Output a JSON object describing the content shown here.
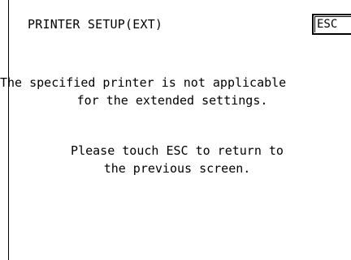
{
  "header": {
    "title": "PRINTER SETUP(EXT)",
    "esc_label": "ESC"
  },
  "message": {
    "line1": "The specified printer is not applicable",
    "line2": "for the extended settings.",
    "line3": "Please touch ESC to return to",
    "line4": "the previous screen."
  },
  "colors": {
    "background": "#ffffff",
    "foreground": "#000000"
  }
}
